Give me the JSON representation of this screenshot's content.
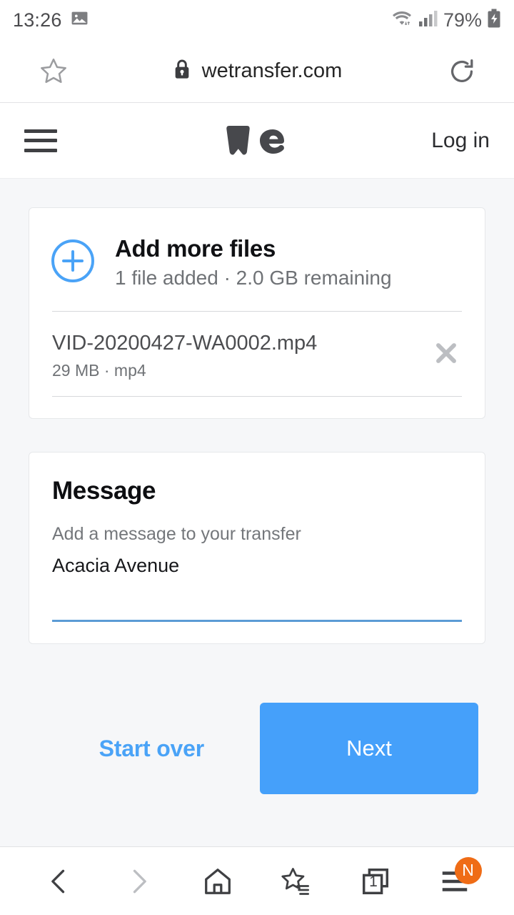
{
  "statusbar": {
    "time": "13:26",
    "gallery_icon": "image-icon",
    "wifi_icon": "wifi-icon",
    "signal_icon": "cellular-signal-icon",
    "battery_percent": "79%",
    "battery_icon": "battery-charging-icon"
  },
  "browser": {
    "bookmark_icon": "star-outline-icon",
    "lock_icon": "lock-icon",
    "url": "wetransfer.com",
    "reload_icon": "reload-icon"
  },
  "site_header": {
    "menu_icon": "hamburger-menu-icon",
    "logo": "wetransfer-we-logo",
    "login_label": "Log in"
  },
  "files_card": {
    "plus_icon": "plus-circle-icon",
    "add_more_title": "Add more files",
    "add_more_sub": "1 file added · 2.0 GB remaining",
    "files": [
      {
        "name": "VID-20200427-WA0002.mp4",
        "meta": "29 MB · mp4",
        "remove_icon": "close-x-icon"
      }
    ]
  },
  "message_card": {
    "title": "Message",
    "placeholder": "Add a message to your transfer",
    "value": "Acacia Avenue"
  },
  "actions": {
    "start_over_label": "Start over",
    "next_label": "Next"
  },
  "bottomnav": {
    "back_icon": "chevron-left-icon",
    "forward_icon": "chevron-right-icon",
    "home_icon": "home-icon",
    "bookmarks_icon": "star-list-icon",
    "tabs_icon": "tabs-icon",
    "tabs_count": "1",
    "menu_icon": "menu-lines-icon",
    "menu_badge": "N"
  },
  "colors": {
    "accent_blue": "#45a0fa",
    "link_blue": "#4aa3f7",
    "underline_blue": "#5b9bd5",
    "page_bg": "#f6f7f9",
    "badge_orange": "#ef6c16",
    "logo_dark": "#47484c"
  }
}
